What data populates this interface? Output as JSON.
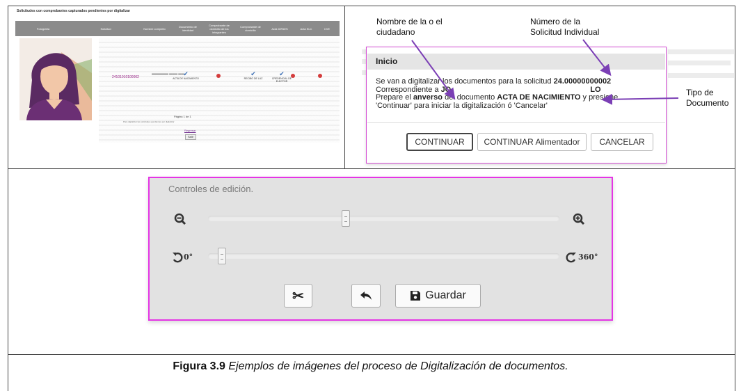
{
  "panel_a": {
    "title": "Solicitudes con comprobantes capturados pendientes por digitalizar",
    "columns": [
      "Fotografía",
      "Solicitud",
      "Nombre completo",
      "Documento de identidad",
      "Comprobante de domicilio de los integrantes",
      "Comprobante de domicilio",
      "Acta DIFAES",
      "Acta SLC",
      "CVE"
    ],
    "request_number": "24101010100002",
    "status_labels": {
      "birth_cert": "ACTA DE NACIMIENTO",
      "id_doc": "RECIBO DE LUZ",
      "voter_id": "CREDENCIAL DE ELECTOR"
    },
    "pagination": "Página 1 de 1",
    "pagination_note": "Para digitalizar las solicitudes pendientes por digitalizar",
    "back_link": "Regresar",
    "exit_button": "Salir"
  },
  "annotations": {
    "citizen_name": "Nombre de la o el\nciudadano",
    "request_number": "Número de la\nSolicitud Individual",
    "doc_type": "Tipo de\nDocumento"
  },
  "dialog": {
    "title": "Inicio",
    "line1_prefix": "Se van a digitalizar los documentos para la solicitud ",
    "line1_number": "24.00000000002",
    "line2_prefix": "Correspondiente a ",
    "line2_name_start": "JO",
    "line2_name_end": "LO",
    "line3_a": "Prepare el ",
    "line3_b": "anverso",
    "line3_c": " del documento ",
    "line3_d": "ACTA DE NACIMIENTO",
    "line3_e": " y presione",
    "line4": "'Continuar' para iniciar la digitalización ó 'Cancelar'",
    "buttons": {
      "continue": "CONTINUAR",
      "continue_feeder": "CONTINUAR Alimentador",
      "cancel": "CANCELAR"
    }
  },
  "edit_controls": {
    "caption": "Controles de edición.",
    "zoom_level": 0.39,
    "rotation_level": 0.0,
    "rotate_left_label": "0°",
    "rotate_right_label": "360°",
    "save_label": "Guardar"
  },
  "figure_caption": {
    "label": "Figura 3.9",
    "text": " Ejemplos de imágenes del proceso de Digitalización de documentos."
  },
  "colors": {
    "highlight_border": "#e534e5",
    "arrow": "#7b3fb5",
    "accent_purple": "#9b2a8a"
  }
}
